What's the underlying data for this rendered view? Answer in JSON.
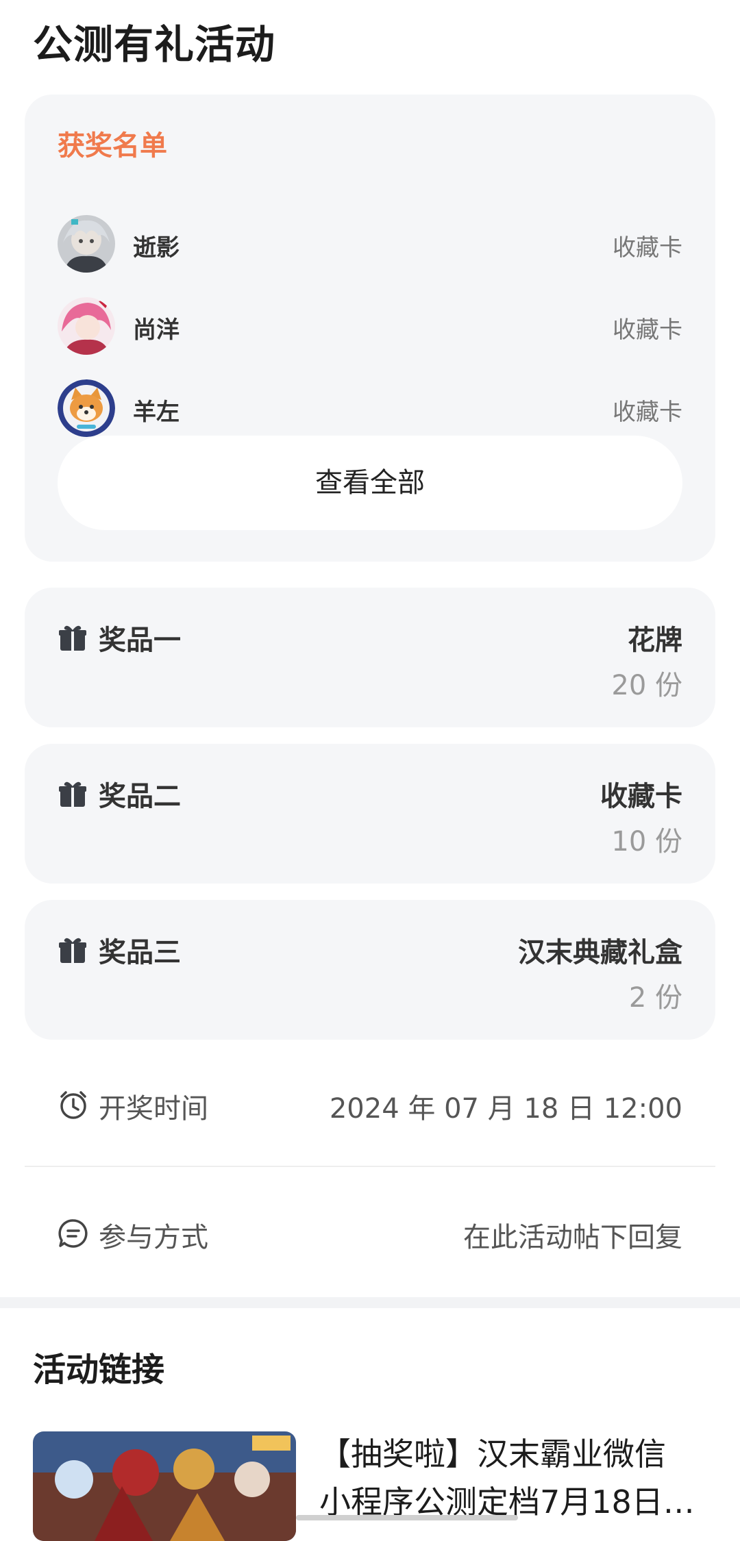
{
  "page": {
    "title": "公测有礼活动"
  },
  "winners": {
    "title": "获奖名单",
    "items": [
      {
        "name": "逝影",
        "prize": "收藏卡",
        "avatar_icon": "anime-girl-silver-hair-avatar"
      },
      {
        "name": "尚洋",
        "prize": "收藏卡",
        "avatar_icon": "anime-girl-pink-hair-avatar"
      },
      {
        "name": "羊左",
        "prize": "收藏卡",
        "avatar_icon": "shiba-dog-avatar"
      }
    ],
    "view_all_label": "查看全部"
  },
  "prizes": [
    {
      "label": "奖品一",
      "name": "花牌",
      "quantity": "20 份",
      "icon": "gift-icon"
    },
    {
      "label": "奖品二",
      "name": "收藏卡",
      "quantity": "10 份",
      "icon": "gift-icon"
    },
    {
      "label": "奖品三",
      "name": "汉末典藏礼盒",
      "quantity": "2 份",
      "icon": "gift-icon"
    }
  ],
  "draw_time": {
    "label": "开奖时间",
    "value": "2024 年 07 月 18 日 12:00",
    "icon": "alarm-clock-icon"
  },
  "participation": {
    "label": "参与方式",
    "value": "在此活动帖下回复",
    "icon": "chat-bubble-icon"
  },
  "activity_link": {
    "section_title": "活动链接",
    "title_line1": "【抽奖啦】汉末霸业微信",
    "title_line2": "小程序公测定档7月18日…"
  },
  "colors": {
    "accent_orange": "#f07a4c",
    "card_background": "#f5f6f8",
    "text_primary": "#1c1c1c",
    "text_secondary": "#9a9a9a"
  }
}
